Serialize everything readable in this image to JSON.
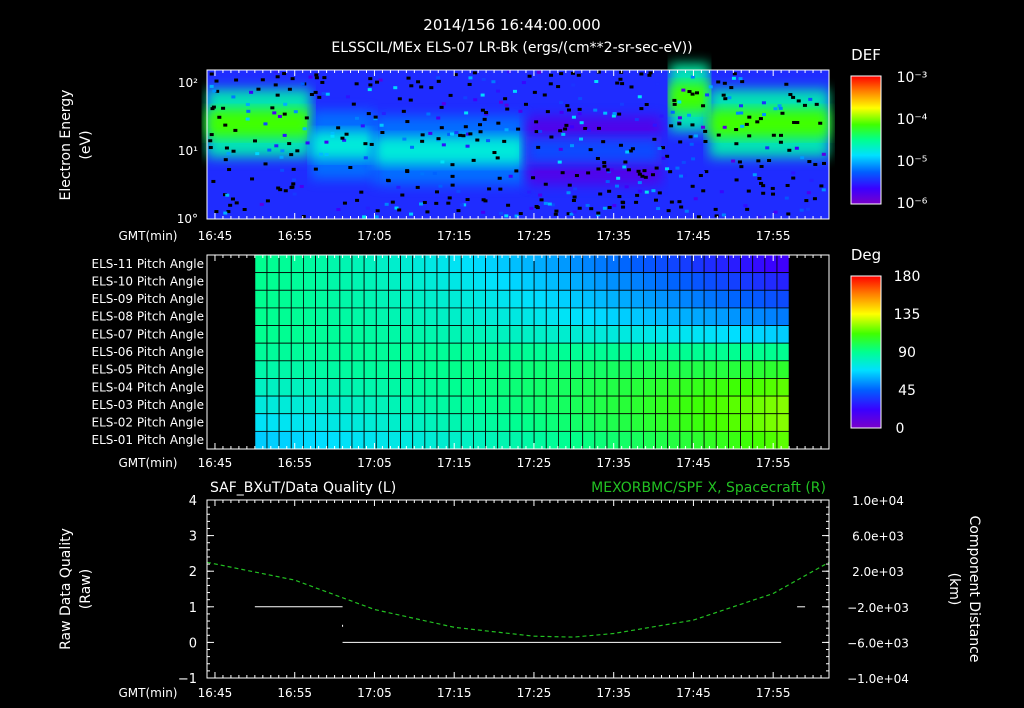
{
  "header": {
    "timestamp": "2014/156 16:44:00.000",
    "title": "ELSSCIL/MEx ELS-07 LR-Bk   (ergs/(cm**2-sr-sec-eV))"
  },
  "colors": {
    "background": "#000000",
    "foreground": "#ffffff",
    "spacecraft_line": "#22c022",
    "spacecraft_label": "#22c022"
  },
  "time_axis": {
    "label": "GMT(min)",
    "ticks": [
      "16:45",
      "16:55",
      "17:05",
      "17:15",
      "17:25",
      "17:35",
      "17:45",
      "17:55"
    ]
  },
  "chart_data": [
    {
      "type": "heatmap",
      "name": "electron-spectrogram",
      "ylabel": "Electron Energy",
      "yunit": "(eV)",
      "yscale": "log",
      "ylim": [
        1,
        150
      ],
      "yticks": [
        "10°",
        "10¹",
        "10²"
      ],
      "xlim": [
        "16:44",
        "18:02"
      ],
      "colorbar": {
        "title": "DEF",
        "scale": "log",
        "range": [
          1e-06,
          0.001
        ],
        "ticks": [
          "10⁻³",
          "10⁻⁴",
          "10⁻⁵",
          "10⁻⁶"
        ]
      },
      "features": [
        {
          "start": "16:44",
          "end": "16:57",
          "center_eV": 25,
          "level": "high"
        },
        {
          "start": "16:57",
          "end": "17:05",
          "center_eV": 12,
          "level": "medium"
        },
        {
          "start": "17:05",
          "end": "17:24",
          "center_eV": 10,
          "level": "medium"
        },
        {
          "start": "17:24",
          "end": "17:41",
          "center_eV": 10,
          "level": "low"
        },
        {
          "start": "17:42",
          "end": "17:47",
          "center_eV": 60,
          "level": "high"
        },
        {
          "start": "17:47",
          "end": "18:02",
          "center_eV": 25,
          "level": "high"
        }
      ]
    },
    {
      "type": "heatmap",
      "name": "pitch-angle",
      "rows": [
        "ELS-11 Pitch Angle",
        "ELS-10 Pitch Angle",
        "ELS-09 Pitch Angle",
        "ELS-08 Pitch Angle",
        "ELS-07 Pitch Angle",
        "ELS-06 Pitch Angle",
        "ELS-05 Pitch Angle",
        "ELS-04 Pitch Angle",
        "ELS-03 Pitch Angle",
        "ELS-02 Pitch Angle",
        "ELS-01 Pitch Angle"
      ],
      "xlim": [
        "16:44",
        "18:02"
      ],
      "data_range": [
        "16:50",
        "17:57"
      ],
      "columns": 44,
      "colorbar": {
        "title": "Deg",
        "range": [
          0,
          180
        ],
        "ticks": [
          "180",
          "135",
          "90",
          "45",
          "0"
        ]
      },
      "row_angles_start": [
        90,
        90,
        90,
        90,
        90,
        88,
        85,
        80,
        75,
        70,
        65
      ],
      "row_angles_end": [
        20,
        30,
        40,
        50,
        65,
        90,
        105,
        115,
        120,
        120,
        115
      ]
    },
    {
      "type": "line",
      "name": "data-quality-and-position",
      "title_left": "SAF_BXuT/Data Quality (L)",
      "title_right": "MEXORBMC/SPF X, Spacecraft (R)",
      "ylabel_left": "Raw Data Quality",
      "yunit_left": "(Raw)",
      "ylim_left": [
        -1,
        4
      ],
      "yticks_left": [
        "4",
        "3",
        "2",
        "1",
        "0",
        "−1"
      ],
      "ylabel_right": "Component Distance",
      "yunit_right": "(km)",
      "ylim_right": [
        -10000,
        10000
      ],
      "yticks_right": [
        "1.0e+04",
        "6.0e+03",
        "2.0e+03",
        "−2.0e+03",
        "−6.0e+03",
        "−1.0e+04"
      ],
      "series": [
        {
          "axis": "left",
          "style": "solid",
          "points": [
            [
              "16:50",
              1
            ],
            [
              "17:01",
              1
            ],
            [
              "17:01",
              0
            ],
            [
              "17:56",
              0
            ],
            [
              "17:58",
              1
            ],
            [
              "17:59",
              1
            ]
          ]
        },
        {
          "axis": "right",
          "style": "dashed",
          "points": [
            [
              "16:44",
              3000
            ],
            [
              "16:55",
              1000
            ],
            [
              "17:05",
              -2300
            ],
            [
              "17:15",
              -4300
            ],
            [
              "17:25",
              -5300
            ],
            [
              "17:30",
              -5400
            ],
            [
              "17:35",
              -5000
            ],
            [
              "17:45",
              -3500
            ],
            [
              "17:55",
              -500
            ],
            [
              "18:02",
              3000
            ]
          ]
        }
      ]
    }
  ]
}
